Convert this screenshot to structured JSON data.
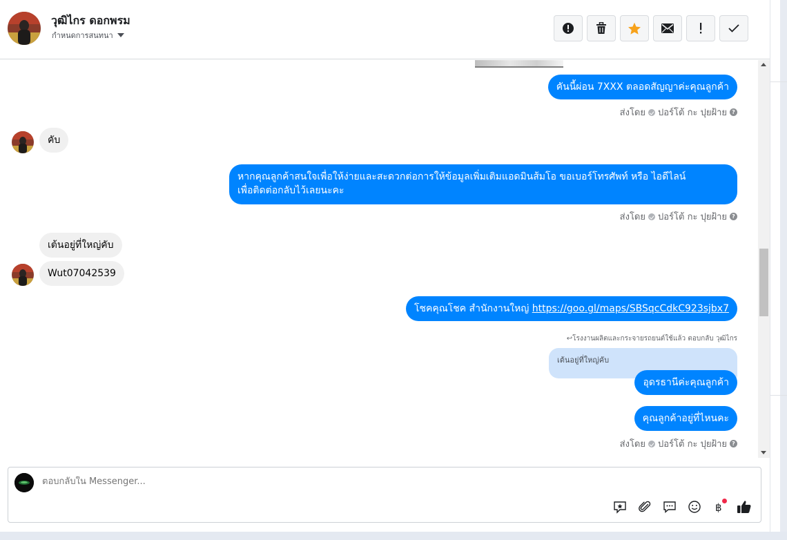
{
  "header": {
    "contact_name": "วุฒิไกร ดอกพรม",
    "conversation_settings": "กำหนดการสนทนา",
    "actions": [
      "spam",
      "delete",
      "star",
      "mark-unread",
      "important",
      "done"
    ]
  },
  "messages": {
    "m1": "คันนี้ผ่อน 7XXX ตลอดสัญญาค่ะคุณลูกค้า",
    "m2": "คับ",
    "m3_line1": "หากคุณลูกค้าสนใจเพื่อให้ง่ายและสะดวกต่อการให้ข้อมูลเพิ่มเติมแอดมินส้มโอ ขอเบอร์โทรศัพท์ หรือ ไอดีไลน์",
    "m3_line2": "เพื่อติดต่อกลับไว้เลยนะคะ",
    "m4": "เต้นอยู่ที่ใหญ่คับ",
    "m5": "Wut07042539",
    "m6_text": "โชคคุณโชค สำนักงานใหญ่ ",
    "m6_link": "https://goo.gl/maps/SBSqcCdkC923sjbx7",
    "reply_note": "↩โรงงานผลิตและกระจายรถยนต์ใช้แล้ว ตอบกลับ วุฒิไกร",
    "quoted_text": "เต้นอยู่ที่ใหญ่คับ",
    "m7": "อุดรธานีค่ะคุณลูกค้า",
    "m8": "คุณลูกค้าอยู่ที่ไหนคะ"
  },
  "sent_by": {
    "prefix": "ส่งโดย",
    "name": "ปอร์โต้ กะ ปุยฝ้าย"
  },
  "composer": {
    "placeholder": "ตอบกลับใน Messenger...",
    "tools": [
      "sticker-icon",
      "attachment-icon",
      "saved-replies-icon",
      "emoji-icon",
      "payment-icon",
      "like-icon"
    ]
  },
  "colors": {
    "outgoing": "#0084ff",
    "incoming": "#f0f0f0",
    "quoted": "#cfe3fb"
  }
}
